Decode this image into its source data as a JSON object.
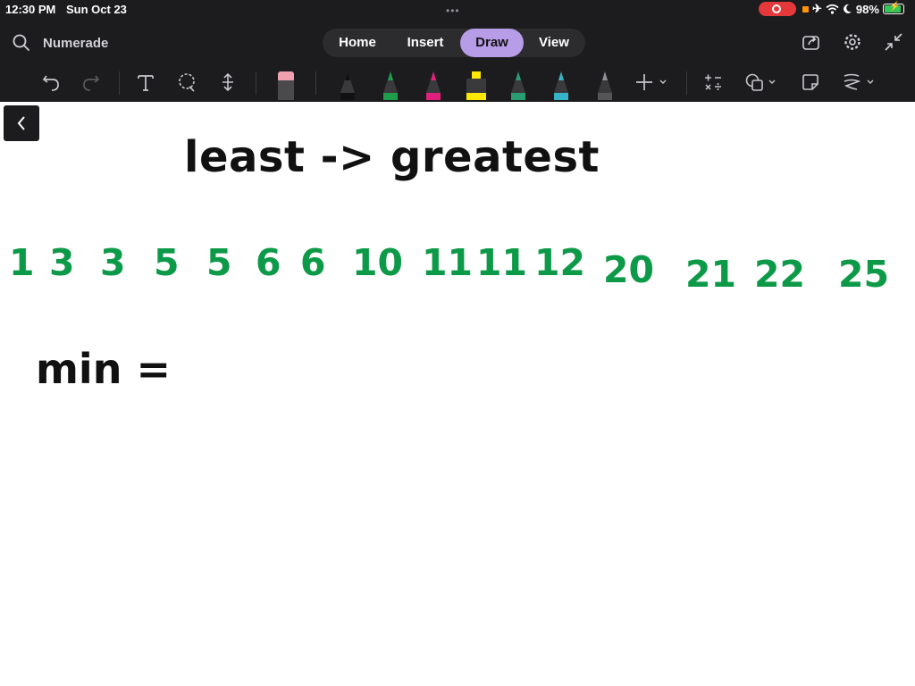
{
  "status_bar": {
    "time": "12:30 PM",
    "date": "Sun Oct 23",
    "battery_percent": "98%",
    "battery_level": 0.98,
    "record_color": "#e5383b",
    "battery_color": "#34c759"
  },
  "header": {
    "app_title": "Numerade",
    "tabs": [
      {
        "label": "Home",
        "active": false
      },
      {
        "label": "Insert",
        "active": false
      },
      {
        "label": "Draw",
        "active": true
      },
      {
        "label": "View",
        "active": false
      }
    ],
    "active_tab_color": "#b79ce8",
    "right_icons": [
      "share-icon",
      "settings-icon",
      "collapse-icon"
    ]
  },
  "toolbar": {
    "tools": [
      "undo-icon",
      "redo-icon",
      "text-tool-icon",
      "lasso-icon",
      "space-insert-icon",
      "eraser-icon",
      "black-pen-icon",
      "green-pen-icon",
      "magenta-pen-icon",
      "yellow-highlighter-icon",
      "teal-pen-icon",
      "cyan-pen-icon",
      "gray-pen-icon",
      "add-pen-icon",
      "math-icon",
      "shapes-icon",
      "sticker-icon",
      "ink-style-icon"
    ],
    "pen_colors": [
      "#111111",
      "#1f9d4a",
      "#e0207c",
      "#ffe800",
      "#2a9c72",
      "#36b3c6",
      "#555555"
    ]
  },
  "canvas": {
    "heading": "least -> greatest",
    "numbers": [
      "1",
      "3",
      "3",
      "5",
      "5",
      "6",
      "6",
      "10",
      "11",
      "11",
      "12",
      "20",
      "21",
      "22",
      "25"
    ],
    "number_color": "#0d9a48",
    "min_label": "min ="
  }
}
